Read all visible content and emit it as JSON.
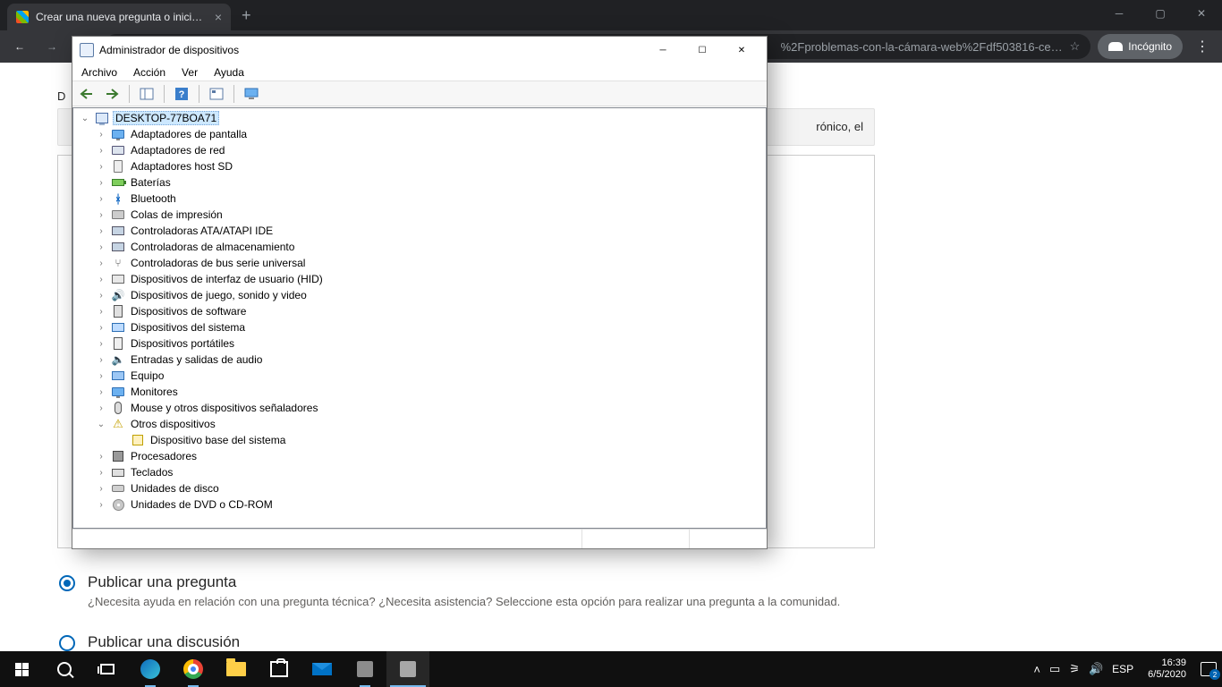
{
  "browser": {
    "tab_title": "Crear una nueva pregunta o inici…",
    "url_fragment": "%2Fproblemas-con-la-cámara-web%2Fdf503816-ce…",
    "incognito_label": "Incógnito"
  },
  "devmgr": {
    "title": "Administrador de dispositivos",
    "menu": {
      "file": "Archivo",
      "action": "Acción",
      "view": "Ver",
      "help": "Ayuda"
    },
    "root": "DESKTOP-77BOA71",
    "nodes": [
      {
        "label": "Adaptadores de pantalla",
        "icon": "i-mon"
      },
      {
        "label": "Adaptadores de red",
        "icon": "i-net"
      },
      {
        "label": "Adaptadores host SD",
        "icon": "i-sd"
      },
      {
        "label": "Baterías",
        "icon": "i-bat"
      },
      {
        "label": "Bluetooth",
        "icon": "i-bt",
        "glyph": "ᚼ"
      },
      {
        "label": "Colas de impresión",
        "icon": "i-prn"
      },
      {
        "label": "Controladoras ATA/ATAPI IDE",
        "icon": "i-ctrl"
      },
      {
        "label": "Controladoras de almacenamiento",
        "icon": "i-ctrl"
      },
      {
        "label": "Controladoras de bus serie universal",
        "icon": "i-usb",
        "glyph": "⑂"
      },
      {
        "label": "Dispositivos de interfaz de usuario (HID)",
        "icon": "i-hid"
      },
      {
        "label": "Dispositivos de juego, sonido y video",
        "icon": "i-snd",
        "glyph": "🔊"
      },
      {
        "label": "Dispositivos de software",
        "icon": "i-sw"
      },
      {
        "label": "Dispositivos del sistema",
        "icon": "i-sys"
      },
      {
        "label": "Dispositivos portátiles",
        "icon": "i-port"
      },
      {
        "label": "Entradas y salidas de audio",
        "icon": "i-aud",
        "glyph": "🔈"
      },
      {
        "label": "Equipo",
        "icon": "i-eqp"
      },
      {
        "label": "Monitores",
        "icon": "i-mon"
      },
      {
        "label": "Mouse y otros dispositivos señaladores",
        "icon": "i-ms"
      },
      {
        "label": "Otros dispositivos",
        "icon": "i-oth",
        "glyph": "⚠",
        "expanded": true,
        "children": [
          {
            "label": "Dispositivo base del sistema",
            "icon": "i-unk"
          }
        ]
      },
      {
        "label": "Procesadores",
        "icon": "i-cpu"
      },
      {
        "label": "Teclados",
        "icon": "i-kb"
      },
      {
        "label": "Unidades de disco",
        "icon": "i-hdd"
      },
      {
        "label": "Unidades de DVD o CD-ROM",
        "icon": "i-dvd"
      }
    ]
  },
  "page": {
    "hint_suffix": "rónico, el",
    "radio1_title": "Publicar una pregunta",
    "radio1_sub": "¿Necesita ayuda en relación con una pregunta técnica? ¿Necesita asistencia? Seleccione esta opción para realizar una pregunta a la comunidad.",
    "radio2_title": "Publicar una discusión"
  },
  "taskbar": {
    "lang": "ESP",
    "time": "16:39",
    "date": "6/5/2020",
    "notif_count": "2"
  }
}
